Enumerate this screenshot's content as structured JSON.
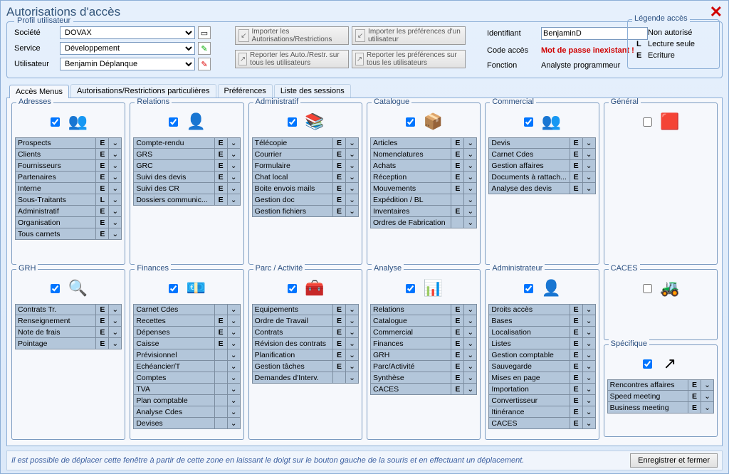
{
  "title": "Autorisations d'accès",
  "profile": {
    "label": "Profil utilisateur",
    "societe_lbl": "Société",
    "societe": "DOVAX",
    "service_lbl": "Service",
    "service": "Développement",
    "utilisateur_lbl": "Utilisateur",
    "utilisateur": "Benjamin Déplanque"
  },
  "buttons": {
    "b1": "Importer les Autorisations/Restrictions",
    "b2": "Importer les préférences d'un utilisateur",
    "b3": "Reporter les Auto./Restr. sur tous les utilisateurs",
    "b4": "Reporter les préférences sur tous les utilisateurs"
  },
  "ident": {
    "id_lbl": "Identifiant",
    "id_val": "BenjaminD",
    "code_lbl": "Code accès",
    "code_val": "Mot de passe inexistant !",
    "fonc_lbl": "Fonction",
    "fonc_val": "Analyste programmeur"
  },
  "legend": {
    "title": "Légende accès",
    "l1": "Non autorisé",
    "l2l": "L",
    "l2": "Lecture seule",
    "l3l": "E",
    "l3": "Ecriture"
  },
  "tabs": [
    "Accès Menus",
    "Autorisations/Restrictions particulières",
    "Préférences",
    "Liste des sessions"
  ],
  "panels": {
    "adresses": {
      "title": "Adresses",
      "items": [
        [
          "Prospects",
          "E"
        ],
        [
          "Clients",
          "E"
        ],
        [
          "Fournisseurs",
          "E"
        ],
        [
          "Partenaires",
          "E"
        ],
        [
          "Interne",
          "E"
        ],
        [
          "Sous-Traitants",
          "L"
        ],
        [
          "Administratif",
          "E"
        ],
        [
          "Organisation",
          "E"
        ],
        [
          "Tous carnets",
          "E"
        ]
      ]
    },
    "relations": {
      "title": "Relations",
      "items": [
        [
          "Compte-rendu",
          "E"
        ],
        [
          "GRS",
          "E"
        ],
        [
          "GRC",
          "E"
        ],
        [
          "Suivi des devis",
          "E"
        ],
        [
          "Suivi des CR",
          "E"
        ],
        [
          "Dossiers communic...",
          "E"
        ]
      ]
    },
    "admin": {
      "title": "Administratif",
      "items": [
        [
          "Télécopie",
          "E"
        ],
        [
          "Courrier",
          "E"
        ],
        [
          "Formulaire",
          "E"
        ],
        [
          "Chat local",
          "E"
        ],
        [
          "Boite envois mails",
          "E"
        ],
        [
          "Gestion doc",
          "E"
        ],
        [
          "Gestion fichiers",
          "E"
        ]
      ]
    },
    "catalogue": {
      "title": "Catalogue",
      "items": [
        [
          "Articles",
          "E"
        ],
        [
          "Nomenclatures",
          "E"
        ],
        [
          "Achats",
          "E"
        ],
        [
          "Réception",
          "E"
        ],
        [
          "Mouvements",
          "E"
        ],
        [
          "Expédition / BL",
          ""
        ],
        [
          "Inventaires",
          "E"
        ],
        [
          "Ordres de Fabrication",
          ""
        ]
      ]
    },
    "commercial": {
      "title": "Commercial",
      "items": [
        [
          "Devis",
          "E"
        ],
        [
          "Carnet Cdes",
          "E"
        ],
        [
          "Gestion affaires",
          "E"
        ],
        [
          "Documents à rattach...",
          "E"
        ],
        [
          "Analyse des devis",
          "E"
        ]
      ]
    },
    "general": {
      "title": "Général",
      "items": []
    },
    "grh": {
      "title": "GRH",
      "items": [
        [
          "Contrats Tr.",
          "E"
        ],
        [
          "Renseignement",
          "E"
        ],
        [
          "Note de frais",
          "E"
        ],
        [
          "Pointage",
          "E"
        ]
      ]
    },
    "finances": {
      "title": "Finances",
      "items": [
        [
          "Carnet Cdes",
          ""
        ],
        [
          "Recettes",
          "E"
        ],
        [
          "Dépenses",
          "E"
        ],
        [
          "Caisse",
          "E"
        ],
        [
          "Prévisionnel",
          ""
        ],
        [
          "Echéancier/T",
          ""
        ],
        [
          "Comptes",
          ""
        ],
        [
          "TVA",
          ""
        ],
        [
          "Plan comptable",
          ""
        ],
        [
          "Analyse Cdes",
          ""
        ],
        [
          "Devises",
          ""
        ]
      ]
    },
    "parc": {
      "title": "Parc / Activité",
      "items": [
        [
          "Equipements",
          "E"
        ],
        [
          "Ordre de Travail",
          "E"
        ],
        [
          "Contrats",
          "E"
        ],
        [
          "Révision des contrats",
          "E"
        ],
        [
          "Planification",
          "E"
        ],
        [
          "Gestion tâches",
          "E"
        ],
        [
          "Demandes d'Interv.",
          ""
        ]
      ]
    },
    "analyse": {
      "title": "Analyse",
      "items": [
        [
          "Relations",
          "E"
        ],
        [
          "Catalogue",
          "E"
        ],
        [
          "Commercial",
          "E"
        ],
        [
          "Finances",
          "E"
        ],
        [
          "GRH",
          "E"
        ],
        [
          "Parc/Activité",
          "E"
        ],
        [
          "Synthèse",
          "E"
        ],
        [
          "CACES",
          "E"
        ]
      ]
    },
    "administrateur": {
      "title": "Administrateur",
      "items": [
        [
          "Droits accès",
          "E"
        ],
        [
          "Bases",
          "E"
        ],
        [
          "Localisation",
          "E"
        ],
        [
          "Listes",
          "E"
        ],
        [
          "Gestion comptable",
          "E"
        ],
        [
          "Sauvegarde",
          "E"
        ],
        [
          "Mises en page",
          "E"
        ],
        [
          "Importation",
          "E"
        ],
        [
          "Convertisseur",
          "E"
        ],
        [
          "Itinérance",
          "E"
        ],
        [
          "CACES",
          "E"
        ]
      ]
    },
    "caces": {
      "title": "CACES",
      "items": []
    },
    "spec": {
      "title": "Spécifique",
      "items": [
        [
          "Rencontres affaires",
          "E"
        ],
        [
          "Speed meeting",
          "E"
        ],
        [
          "Business meeting",
          "E"
        ]
      ]
    }
  },
  "status": "Il est possible de déplacer cette fenêtre à partir de cette zone en laissant le doigt sur le bouton gauche de la souris et en effectuant un déplacement.",
  "save_btn": "Enregistrer et fermer"
}
